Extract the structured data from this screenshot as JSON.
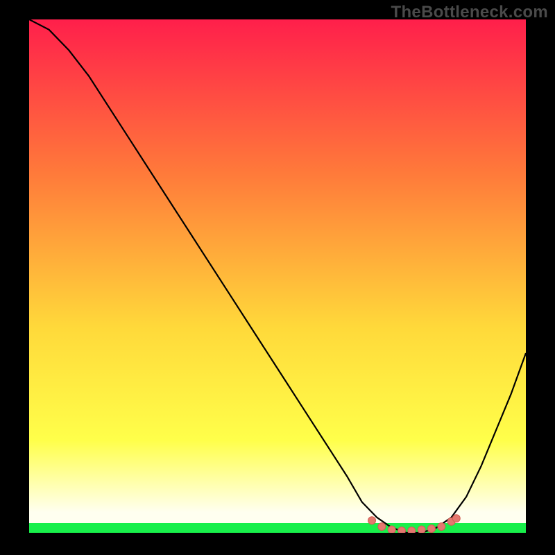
{
  "watermark": "TheBottleneck.com",
  "colors": {
    "background": "#000000",
    "gradient_top": "#ff1f4b",
    "gradient_mid_upper": "#ff7a3a",
    "gradient_mid": "#ffd93a",
    "gradient_mid_lower": "#ffff4a",
    "gradient_bottom": "#fffff0",
    "green_band": "#18f04a",
    "curve": "#000000",
    "marker_fill": "#e4786f",
    "marker_stroke": "#d35d54"
  },
  "chart_data": {
    "type": "line",
    "title": "",
    "xlabel": "",
    "ylabel": "",
    "xlim": [
      0,
      100
    ],
    "ylim": [
      0,
      100
    ],
    "grid": false,
    "series": [
      {
        "name": "bottleneck-curve",
        "x": [
          0,
          4,
          8,
          12,
          16,
          20,
          24,
          28,
          32,
          36,
          40,
          44,
          48,
          52,
          56,
          60,
          64,
          67,
          70,
          73,
          76,
          79,
          82,
          85,
          88,
          91,
          94,
          97,
          100
        ],
        "y": [
          100,
          98,
          94,
          89,
          83,
          77,
          71,
          65,
          59,
          53,
          47,
          41,
          35,
          29,
          23,
          17,
          11,
          6,
          3,
          1,
          0,
          0,
          1,
          3,
          7,
          13,
          20,
          27,
          35
        ]
      }
    ],
    "markers": {
      "name": "optimal-range",
      "x": [
        69,
        71,
        73,
        75,
        77,
        79,
        81,
        83,
        85,
        86
      ],
      "y": [
        2.4,
        1.2,
        0.6,
        0.4,
        0.4,
        0.6,
        0.8,
        1.2,
        2.2,
        2.8
      ]
    }
  }
}
